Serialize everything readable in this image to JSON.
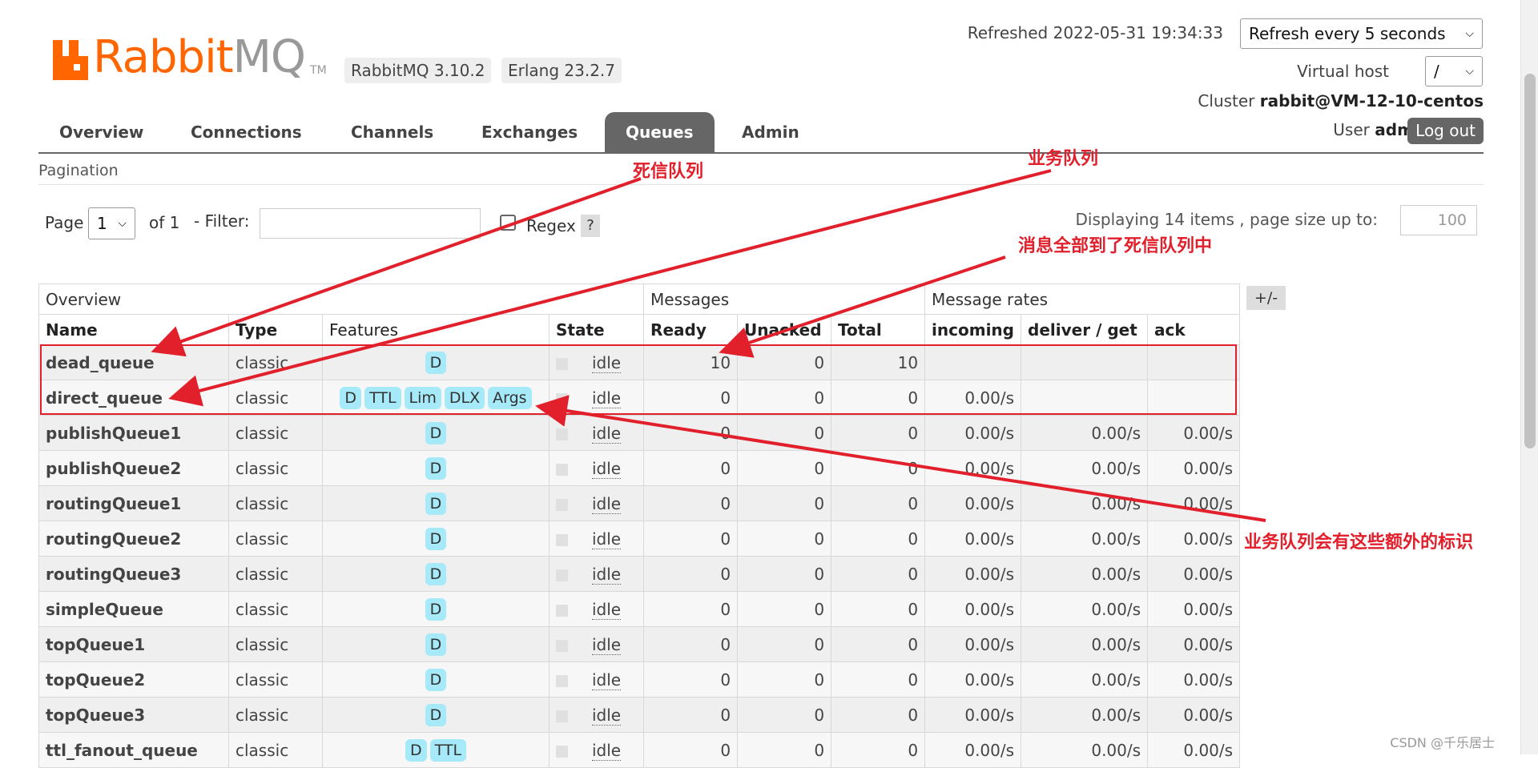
{
  "header": {
    "logo_text_a": "Rabbit",
    "logo_text_b": "MQ",
    "logo_tm": "TM",
    "version": "RabbitMQ 3.10.2",
    "erlang": "Erlang 23.2.7",
    "refreshed": "Refreshed 2022-05-31 19:34:33",
    "refresh_select": "Refresh every 5 seconds",
    "vhost_label": "Virtual host",
    "vhost_value": "/",
    "cluster_label": "Cluster",
    "cluster_value": "rabbit@VM-12-10-centos",
    "user_label": "User",
    "user_value": "admin",
    "logout": "Log out"
  },
  "tabs": [
    "Overview",
    "Connections",
    "Channels",
    "Exchanges",
    "Queues",
    "Admin"
  ],
  "active_tab": "Queues",
  "pagination": {
    "title": "Pagination",
    "page_label": "Page",
    "page_value": "1",
    "of_label": "of 1",
    "filter_label": "- Filter:",
    "regex_label": "Regex",
    "help": "?",
    "displaying": "Displaying 14 items , page size up to:",
    "page_size": "100"
  },
  "table": {
    "group_headers": [
      "Overview",
      "Messages",
      "Message rates"
    ],
    "plus_minus": "+/-",
    "columns": [
      "Name",
      "Type",
      "Features",
      "State",
      "Ready",
      "Unacked",
      "Total",
      "incoming",
      "deliver / get",
      "ack"
    ],
    "rows": [
      {
        "name": "dead_queue",
        "type": "classic",
        "features": [
          "D"
        ],
        "state": "idle",
        "ready": "10",
        "unacked": "0",
        "total": "10",
        "incoming": "",
        "deliver": "",
        "ack": ""
      },
      {
        "name": "direct_queue",
        "type": "classic",
        "features": [
          "D",
          "TTL",
          "Lim",
          "DLX",
          "Args"
        ],
        "state": "idle",
        "ready": "0",
        "unacked": "0",
        "total": "0",
        "incoming": "0.00/s",
        "deliver": "",
        "ack": ""
      },
      {
        "name": "publishQueue1",
        "type": "classic",
        "features": [
          "D"
        ],
        "state": "idle",
        "ready": "0",
        "unacked": "0",
        "total": "0",
        "incoming": "0.00/s",
        "deliver": "0.00/s",
        "ack": "0.00/s"
      },
      {
        "name": "publishQueue2",
        "type": "classic",
        "features": [
          "D"
        ],
        "state": "idle",
        "ready": "0",
        "unacked": "0",
        "total": "0",
        "incoming": "0.00/s",
        "deliver": "0.00/s",
        "ack": "0.00/s"
      },
      {
        "name": "routingQueue1",
        "type": "classic",
        "features": [
          "D"
        ],
        "state": "idle",
        "ready": "0",
        "unacked": "0",
        "total": "0",
        "incoming": "0.00/s",
        "deliver": "0.00/s",
        "ack": "0.00/s"
      },
      {
        "name": "routingQueue2",
        "type": "classic",
        "features": [
          "D"
        ],
        "state": "idle",
        "ready": "0",
        "unacked": "0",
        "total": "0",
        "incoming": "0.00/s",
        "deliver": "0.00/s",
        "ack": "0.00/s"
      },
      {
        "name": "routingQueue3",
        "type": "classic",
        "features": [
          "D"
        ],
        "state": "idle",
        "ready": "0",
        "unacked": "0",
        "total": "0",
        "incoming": "0.00/s",
        "deliver": "0.00/s",
        "ack": "0.00/s"
      },
      {
        "name": "simpleQueue",
        "type": "classic",
        "features": [
          "D"
        ],
        "state": "idle",
        "ready": "0",
        "unacked": "0",
        "total": "0",
        "incoming": "0.00/s",
        "deliver": "0.00/s",
        "ack": "0.00/s"
      },
      {
        "name": "topQueue1",
        "type": "classic",
        "features": [
          "D"
        ],
        "state": "idle",
        "ready": "0",
        "unacked": "0",
        "total": "0",
        "incoming": "0.00/s",
        "deliver": "0.00/s",
        "ack": "0.00/s"
      },
      {
        "name": "topQueue2",
        "type": "classic",
        "features": [
          "D"
        ],
        "state": "idle",
        "ready": "0",
        "unacked": "0",
        "total": "0",
        "incoming": "0.00/s",
        "deliver": "0.00/s",
        "ack": "0.00/s"
      },
      {
        "name": "topQueue3",
        "type": "classic",
        "features": [
          "D"
        ],
        "state": "idle",
        "ready": "0",
        "unacked": "0",
        "total": "0",
        "incoming": "0.00/s",
        "deliver": "0.00/s",
        "ack": "0.00/s"
      },
      {
        "name": "ttl_fanout_queue",
        "type": "classic",
        "features": [
          "D",
          "TTL"
        ],
        "state": "idle",
        "ready": "0",
        "unacked": "0",
        "total": "0",
        "incoming": "0.00/s",
        "deliver": "0.00/s",
        "ack": "0.00/s"
      }
    ]
  },
  "annotations": {
    "dead_queue_note": "死信队列",
    "business_queue_note": "业务队列",
    "messages_note": "消息全部到了死信队列中",
    "features_note": "业务队列会有这些额外的标识",
    "color": "#e1202c"
  },
  "watermark": "CSDN @千乐居士",
  "colors": {
    "brand": "#ff6600",
    "tab_active": "#666666",
    "badge": "#a6e9f8"
  }
}
